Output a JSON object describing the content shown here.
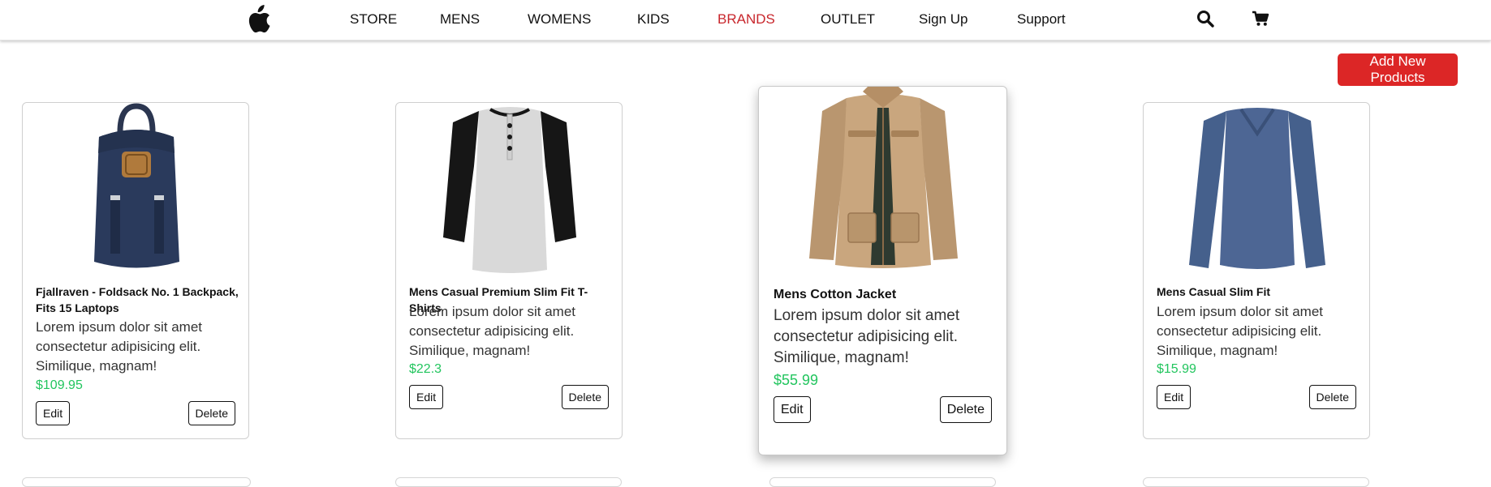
{
  "nav": {
    "links": [
      "STORE",
      "MENS",
      "WOMENS",
      "KIDS",
      "BRANDS",
      "OUTLET",
      "Sign Up",
      "Support"
    ],
    "active_link": "BRANDS",
    "active_color": "#c8262c"
  },
  "actions": {
    "add_label": "Add New Products",
    "add_color": "#dc2626"
  },
  "products": [
    {
      "title": "Fjallraven - Foldsack No. 1 Backpack, Fits 15 Laptops",
      "desc": "Lorem ipsum dolor sit amet consectetur adipisicing elit. Similique, magnam!",
      "price": "$109.95",
      "edit": "Edit",
      "delete": "Delete"
    },
    {
      "title": "Mens Casual Premium Slim Fit T-Shirts",
      "desc": "Lorem ipsum dolor sit amet consectetur adipisicing elit. Similique, magnam!",
      "price": "$22.3",
      "edit": "Edit",
      "delete": "Delete"
    },
    {
      "title": "Mens Cotton Jacket",
      "desc": "Lorem ipsum dolor sit amet consectetur adipisicing elit. Similique, magnam!",
      "price": "$55.99",
      "edit": "Edit",
      "delete": "Delete"
    },
    {
      "title": "Mens Casual Slim Fit",
      "desc": "Lorem ipsum dolor sit amet consectetur adipisicing elit. Similique, magnam!",
      "price": "$15.99",
      "edit": "Edit",
      "delete": "Delete"
    }
  ],
  "colors": {
    "price": "#22c55e"
  }
}
